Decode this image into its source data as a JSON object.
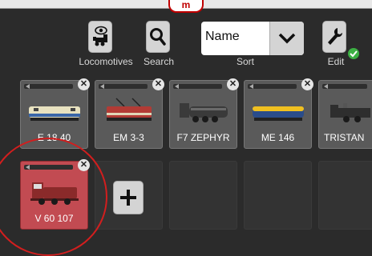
{
  "header": {
    "mode_tab": "m"
  },
  "toolbar": {
    "locomotives_label": "Locomotives",
    "search_label": "Search",
    "sort_value": "Name",
    "sort_label": "Sort",
    "edit_label": "Edit"
  },
  "locomotives": [
    {
      "name": "E 18 40",
      "body": "#e8e2c0",
      "stripe": "#3a66a8"
    },
    {
      "name": "EM 3-3",
      "body": "#b23b35",
      "stripe": "#e0d6b8"
    },
    {
      "name": "F7 ZEPHYR",
      "body": "#3a3a3a",
      "stripe": "#6a6a6a"
    },
    {
      "name": "ME 146",
      "body": "#f0c020",
      "stripe": "#2a4c8a"
    },
    {
      "name": "TRISTAN",
      "body": "#2e2e2e",
      "stripe": "#555555"
    },
    {
      "name": "V 60 107",
      "body": "#8a2a2a",
      "stripe": "#4a1a1a"
    }
  ],
  "colors": {
    "accent_red": "#d21e1e",
    "status_green": "#3cb043"
  }
}
